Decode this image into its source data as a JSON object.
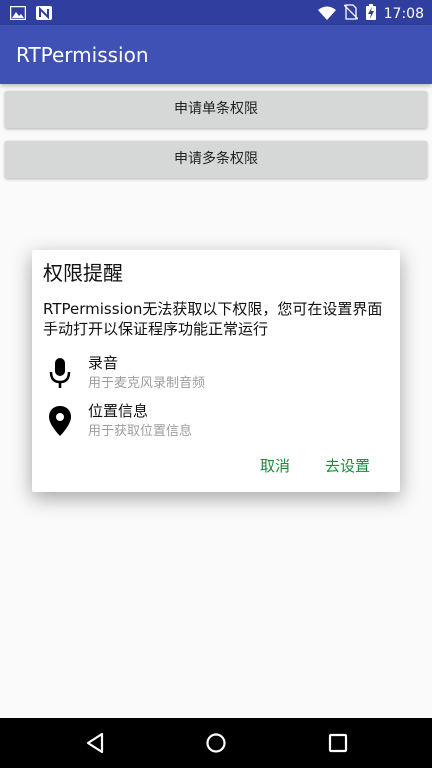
{
  "status_bar": {
    "time": "17:08",
    "left_icons": [
      "image-icon",
      "n-icon"
    ],
    "right_icons": [
      "wifi-icon",
      "no-sim-icon",
      "battery-charging-icon"
    ]
  },
  "app_bar": {
    "title": "RTPermission",
    "color": "#3f51b5",
    "status_color": "#303f9f"
  },
  "buttons": {
    "request_single": "申请单条权限",
    "request_multiple": "申请多条权限"
  },
  "dialog": {
    "title": "权限提醒",
    "message": "RTPermission无法获取以下权限，您可在设置界面手动打开以保证程序功能正常运行",
    "permissions": [
      {
        "icon": "microphone-icon",
        "name": "录音",
        "description": "用于麦克风录制音频"
      },
      {
        "icon": "location-pin-icon",
        "name": "位置信息",
        "description": "用于获取位置信息"
      }
    ],
    "cancel_label": "取消",
    "settings_label": "去设置",
    "button_color": "#1b8a3a"
  },
  "nav_bar": {
    "icons": [
      "back-icon",
      "home-icon",
      "recents-icon"
    ]
  }
}
